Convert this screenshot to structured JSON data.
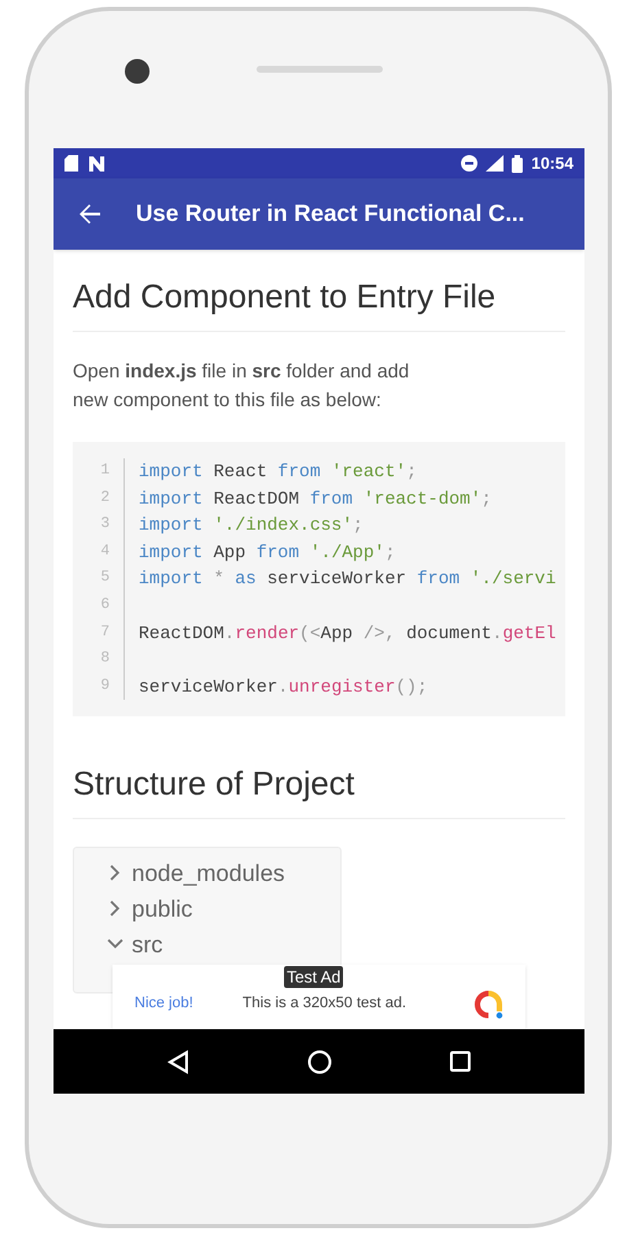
{
  "status_bar": {
    "time": "10:54"
  },
  "app_bar": {
    "title": "Use Router in React Functional C..."
  },
  "sections": [
    {
      "heading": "Add Component to Entry File",
      "paragraph": "Open **index.js** file in **src** folder and add new component to this file as below:",
      "code": [
        {
          "number": "1",
          "tokens": [
            {
              "text": "import",
              "kind": "keyword"
            },
            {
              "text": " React ",
              "kind": "plain"
            },
            {
              "text": "from",
              "kind": "keyword"
            },
            {
              "text": " 'react'",
              "kind": "string"
            },
            {
              "text": ";",
              "kind": "punct"
            }
          ]
        },
        {
          "number": "2",
          "tokens": [
            {
              "text": "import",
              "kind": "keyword"
            },
            {
              "text": " ReactDOM ",
              "kind": "plain"
            },
            {
              "text": "from",
              "kind": "keyword"
            },
            {
              "text": " 'react-dom'",
              "kind": "string"
            },
            {
              "text": ";",
              "kind": "punct"
            }
          ]
        },
        {
          "number": "3",
          "tokens": [
            {
              "text": "import",
              "kind": "keyword"
            },
            {
              "text": " './index.css'",
              "kind": "string"
            },
            {
              "text": ";",
              "kind": "punct"
            }
          ]
        },
        {
          "number": "4",
          "tokens": [
            {
              "text": "import",
              "kind": "keyword"
            },
            {
              "text": " App ",
              "kind": "plain"
            },
            {
              "text": "from",
              "kind": "keyword"
            },
            {
              "text": " './App'",
              "kind": "string"
            },
            {
              "text": ";",
              "kind": "punct"
            }
          ]
        },
        {
          "number": "5",
          "tokens": [
            {
              "text": "import",
              "kind": "keyword"
            },
            {
              "text": " * ",
              "kind": "punct"
            },
            {
              "text": "as",
              "kind": "keyword"
            },
            {
              "text": " serviceWorker ",
              "kind": "plain"
            },
            {
              "text": "from",
              "kind": "keyword"
            },
            {
              "text": " './servi",
              "kind": "string"
            }
          ]
        },
        {
          "number": "6"
        },
        {
          "number": "7",
          "tokens": [
            {
              "text": "ReactDOM",
              "kind": "plain"
            },
            {
              "text": ".",
              "kind": "punct"
            },
            {
              "text": "render",
              "kind": "method"
            },
            {
              "text": "(<",
              "kind": "punct"
            },
            {
              "text": "App",
              "kind": "plain"
            },
            {
              "text": " />, ",
              "kind": "punct"
            },
            {
              "text": "document",
              "kind": "plain"
            },
            {
              "text": ".",
              "kind": "punct"
            },
            {
              "text": "getEl",
              "kind": "method"
            }
          ]
        },
        {
          "number": "8"
        },
        {
          "number": "9",
          "tokens": [
            {
              "text": "serviceWorker",
              "kind": "plain"
            },
            {
              "text": ".",
              "kind": "punct"
            },
            {
              "text": "unregister",
              "kind": "method"
            },
            {
              "text": "();",
              "kind": "punct"
            }
          ]
        }
      ]
    },
    {
      "heading": "Structure of Project",
      "tree": [
        {
          "label": "node_modules",
          "expanded": false
        },
        {
          "label": "public",
          "expanded": false
        },
        {
          "label": "src",
          "expanded": true
        }
      ]
    }
  ],
  "ad": {
    "badge": "Test Ad",
    "headline": "Nice job!",
    "text": "This is a 320x50 test ad."
  }
}
